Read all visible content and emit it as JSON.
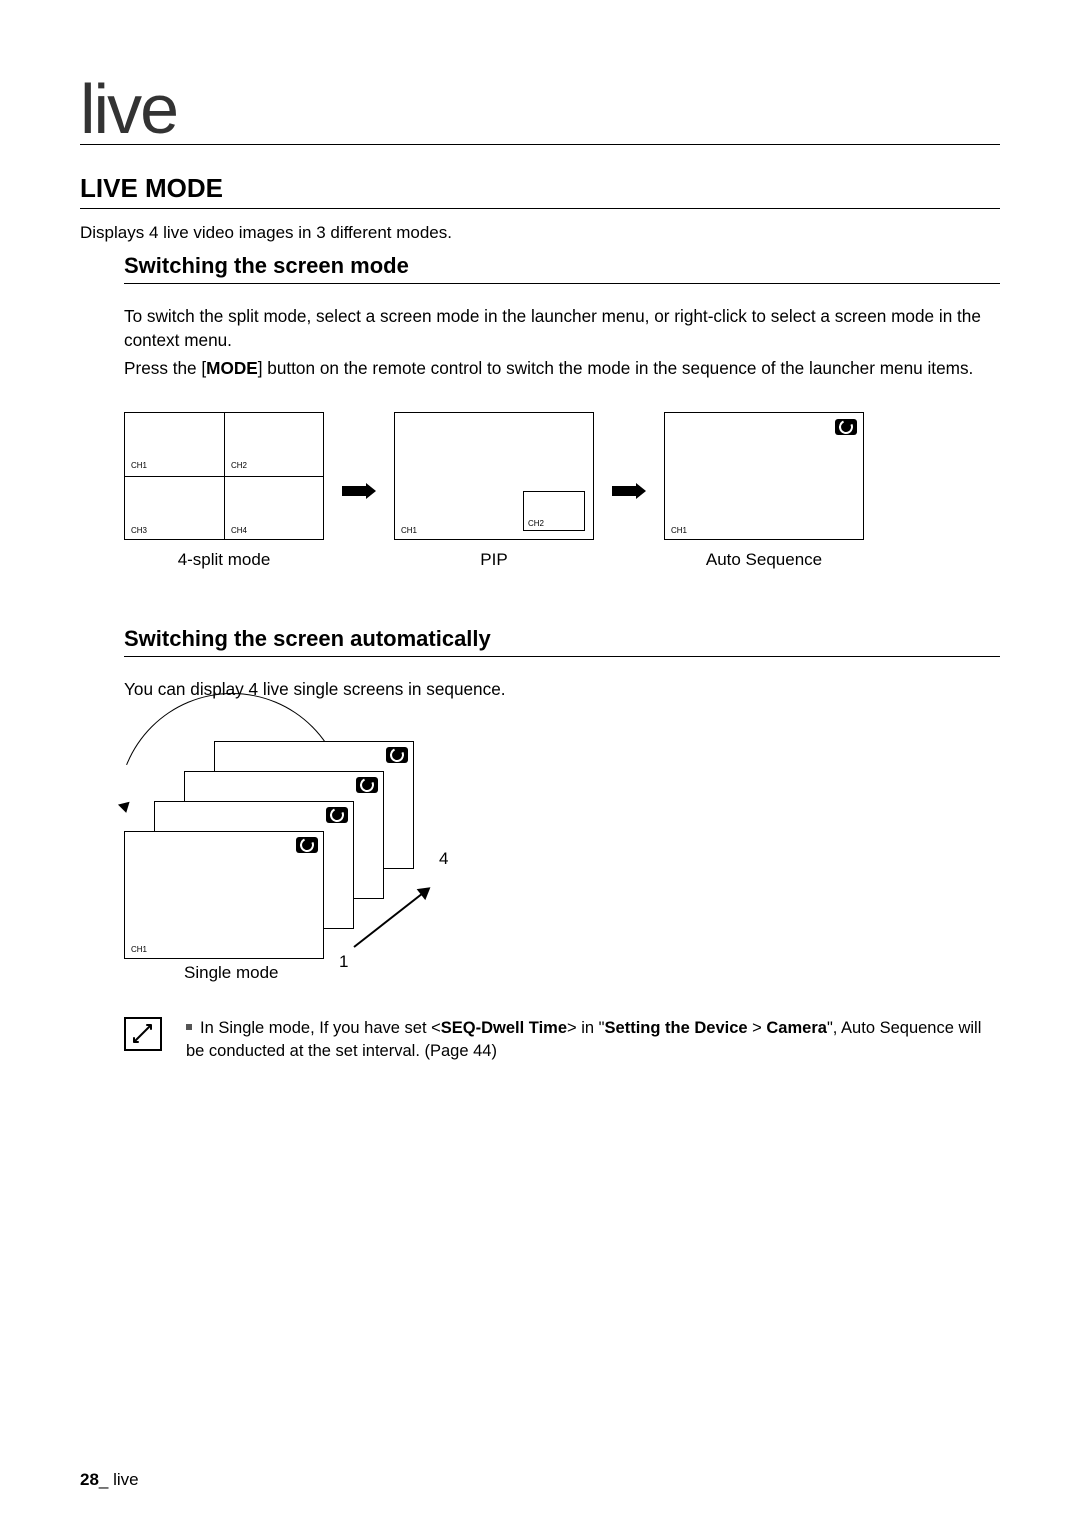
{
  "chapterTitle": "live",
  "section": {
    "title": "LIVE MODE",
    "desc": "Displays 4 live video images in 3 different modes."
  },
  "switchMode": {
    "title": "Switching the screen mode",
    "body1": "To switch the split mode, select a screen mode in the launcher menu, or right-click to select a screen mode in the context menu.",
    "body2a": "Press the [",
    "body2bold": "MODE",
    "body2b": "] button on the remote control to switch the mode in the sequence of the launcher menu items."
  },
  "modes": {
    "splitCaption": "4-split mode",
    "pipCaption": "PIP",
    "seqCaption": "Auto Sequence",
    "ch1": "CH1",
    "ch2": "CH2",
    "ch3": "CH3",
    "ch4": "CH4"
  },
  "switchAuto": {
    "title": "Switching the screen automatically",
    "body": "You can display 4 live single screens in sequence.",
    "singleCaption": "Single mode",
    "numFront": "1",
    "numBack": "4"
  },
  "note": {
    "pre": "In Single mode, If you have set <",
    "bold1": "SEQ-Dwell Time",
    "mid": "> in \"",
    "bold2": "Setting the Device",
    "mid2": " > ",
    "bold3": "Camera",
    "post": "\", Auto Sequence will be conducted at the set interval. (Page 44)"
  },
  "footer": {
    "page": "28",
    "sep": "_",
    "chapter": " live"
  }
}
